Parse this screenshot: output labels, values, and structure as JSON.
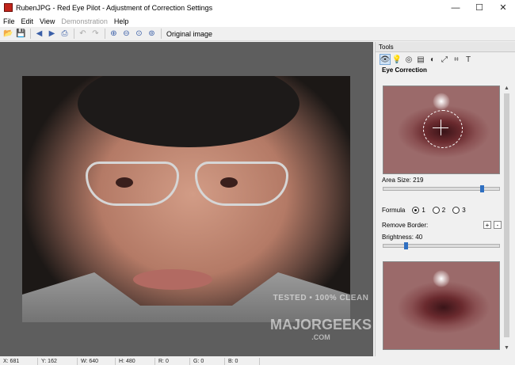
{
  "window": {
    "title": "RubenJPG - Red Eye Pilot - Adjustment of Correction Settings"
  },
  "menu": {
    "file": "File",
    "edit": "Edit",
    "view": "View",
    "demonstration": "Demonstration",
    "help": "Help"
  },
  "toolbar": {
    "original_label": "Original image"
  },
  "tools": {
    "header": "Tools",
    "section": "Eye Correction",
    "area_size_label": "Area Size: 219",
    "area_size_fraction": 0.85,
    "formula_label": "Formula",
    "formula_options": [
      "1",
      "2",
      "3"
    ],
    "formula_selected": "1",
    "remove_border_label": "Remove Border:",
    "plus": "+",
    "minus": "-",
    "brightness_label": "Brightness: 40",
    "brightness_fraction": 0.18
  },
  "watermark": {
    "line1": "TESTED • 100% CLEAN",
    "line2": "MAJORGEEKS",
    "line3": ".COM"
  },
  "status": {
    "x": "X: 681",
    "y": "Y: 162",
    "w": "W: 640",
    "h": "H: 480",
    "r": "R: 0",
    "g": "G: 0",
    "b": "B: 0"
  },
  "colors": {
    "accent": "#2f6fc1",
    "canvas": "#5e5e5e"
  }
}
